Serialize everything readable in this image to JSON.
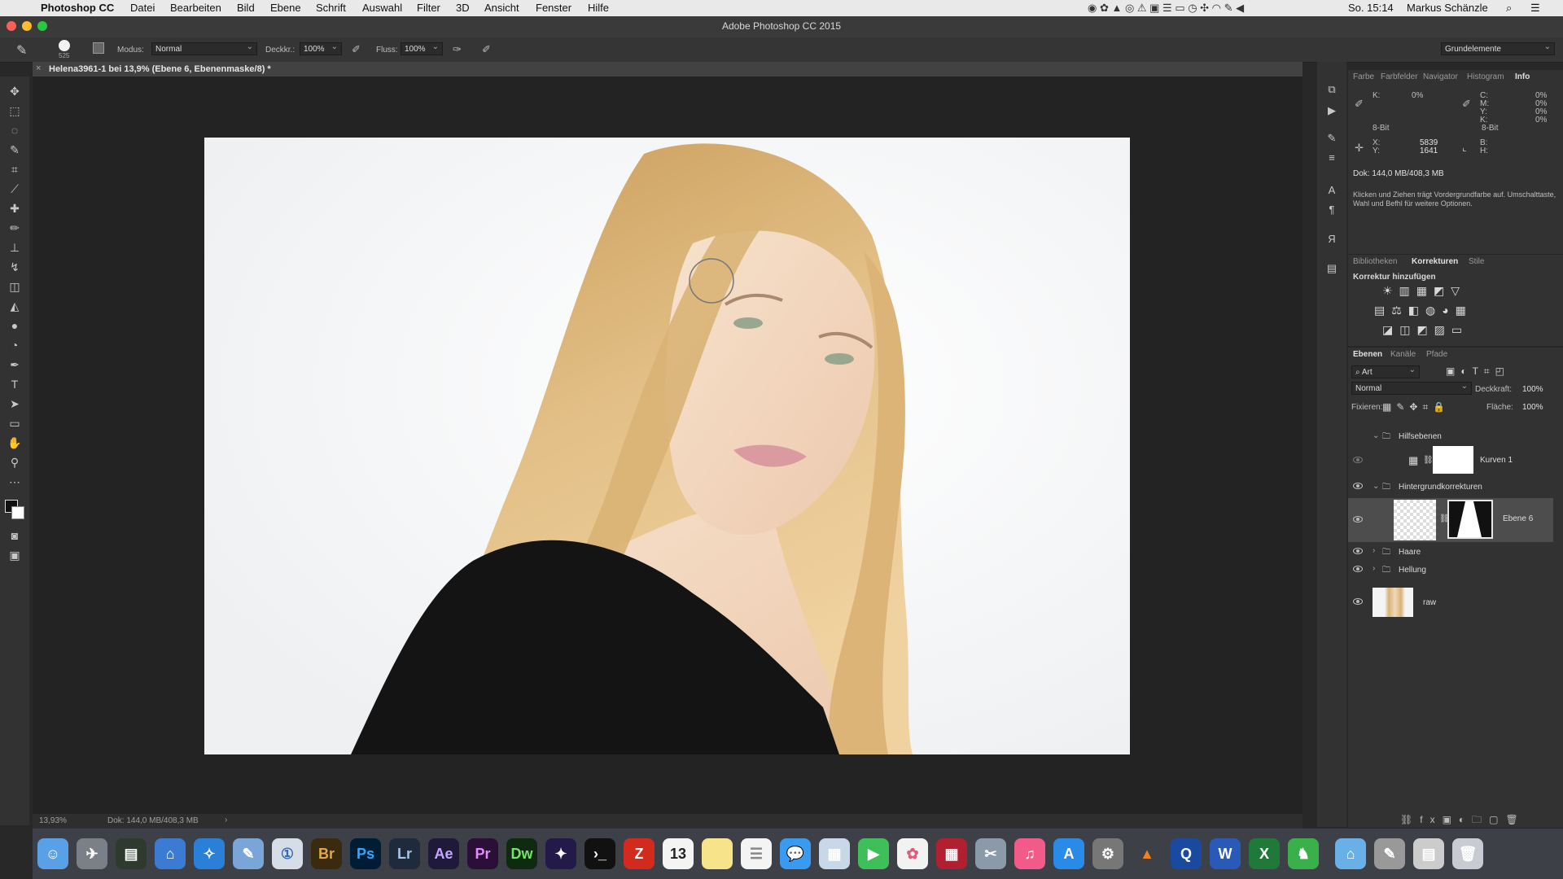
{
  "menubar": {
    "app_name": "Photoshop CC",
    "items": [
      "Datei",
      "Bearbeiten",
      "Bild",
      "Ebene",
      "Schrift",
      "Auswahl",
      "Filter",
      "3D",
      "Ansicht",
      "Fenster",
      "Hilfe"
    ],
    "clock": "So. 15:14",
    "user": "Markus Schänzle"
  },
  "window": {
    "title": "Adobe Photoshop CC 2015"
  },
  "options_bar": {
    "brush_size": "525",
    "modus_label": "Modus:",
    "modus_value": "Normal",
    "deckkr_label": "Deckkr.:",
    "deckkr_value": "100%",
    "fluss_label": "Fluss:",
    "fluss_value": "100%",
    "workspace": "Grundelemente"
  },
  "document": {
    "tab_title": "Helena3961-1 bei 13,9% (Ebene 6, Ebenenmaske/8) *"
  },
  "info_panel": {
    "tabs": [
      "Farbe",
      "Farbfelder",
      "Navigator",
      "Histogram",
      "Info"
    ],
    "active_tab": "Info",
    "k_label": "K:",
    "k_value": "0%",
    "cmyk_labels": [
      "C:",
      "M:",
      "Y:",
      "K:"
    ],
    "cmyk_values": [
      "0%",
      "0%",
      "0%",
      "0%"
    ],
    "bit_left": "8-Bit",
    "bit_right": "8-Bit",
    "x_label": "X:",
    "x_value": "5839",
    "y_label": "Y:",
    "y_value": "1641",
    "b_label": "B:",
    "h_label": "H:",
    "doc_info": "Dok: 144,0 MB/408,3 MB",
    "hint": "Klicken und Ziehen trägt Vordergrundfarbe auf. Umschalttaste, Wahl und Befhl für weitere Optionen."
  },
  "adjustments_panel": {
    "tabs": [
      "Bibliotheken",
      "Korrekturen",
      "Stile"
    ],
    "active_tab": "Korrekturen",
    "heading": "Korrektur hinzufügen"
  },
  "layers_panel": {
    "tabs": [
      "Ebenen",
      "Kanäle",
      "Pfade"
    ],
    "active_tab": "Ebenen",
    "filter_value": "Art",
    "blend_mode": "Normal",
    "opacity_label": "Deckkraft:",
    "opacity_value": "100%",
    "lock_label": "Fixieren:",
    "fill_label": "Fläche:",
    "fill_value": "100%",
    "layers": [
      {
        "name": "Hilfsebenen",
        "kind": "group"
      },
      {
        "name": "Kurven 1",
        "kind": "adjustment"
      },
      {
        "name": "Hintergrundkorrekturen",
        "kind": "group"
      },
      {
        "name": "Ebene 6",
        "kind": "masked",
        "selected": true
      },
      {
        "name": "Haare",
        "kind": "group"
      },
      {
        "name": "Hellung",
        "kind": "group"
      },
      {
        "name": "raw",
        "kind": "image"
      }
    ]
  },
  "status_bar": {
    "zoom": "13,93%",
    "doc": "Dok: 144,0 MB/408,3 MB"
  },
  "dock": {
    "labels": [
      "Br",
      "Ps",
      "Lr",
      "Ae",
      "Pr",
      "Dw",
      "W"
    ],
    "calendar_day": "13"
  },
  "colors": {
    "ps_blue": "#31a8ff",
    "lr_blue": "#a9c4ea",
    "accent_red": "#d32a1e"
  }
}
